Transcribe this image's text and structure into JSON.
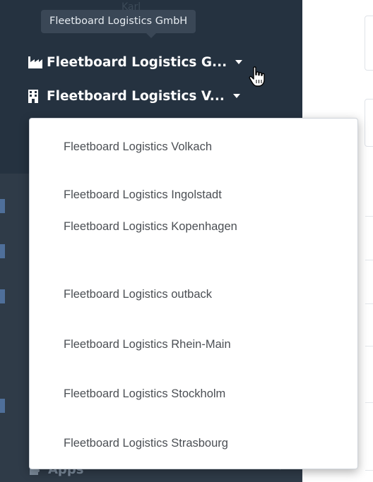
{
  "tooltip": {
    "text": "Fleetboard Logistics GmbH"
  },
  "sidebar": {
    "faint_text": "Karl",
    "org_primary": {
      "label": "Fleetboard Logistics G...",
      "icon": "industry-icon"
    },
    "org_secondary": {
      "label": "Fleetboard Logistics V...",
      "icon": "building-icon"
    },
    "apps": {
      "label": "Apps",
      "icon": "puzzle-icon"
    }
  },
  "dropdown": {
    "items": [
      "Fleetboard Logistics Volkach",
      "Fleetboard Logistics Ingolstadt",
      "Fleetboard Logistics Kopenhagen",
      "Fleetboard Logistics outback",
      "Fleetboard Logistics Rhein-Main",
      "Fleetboard Logistics Stockholm",
      "Fleetboard Logistics Strasbourg"
    ]
  },
  "colors": {
    "sidebar_bg": "#2f3b48",
    "sidebar_top_bg": "#253240",
    "tooltip_bg": "#3a4756",
    "dropdown_text": "#4b4f54"
  }
}
